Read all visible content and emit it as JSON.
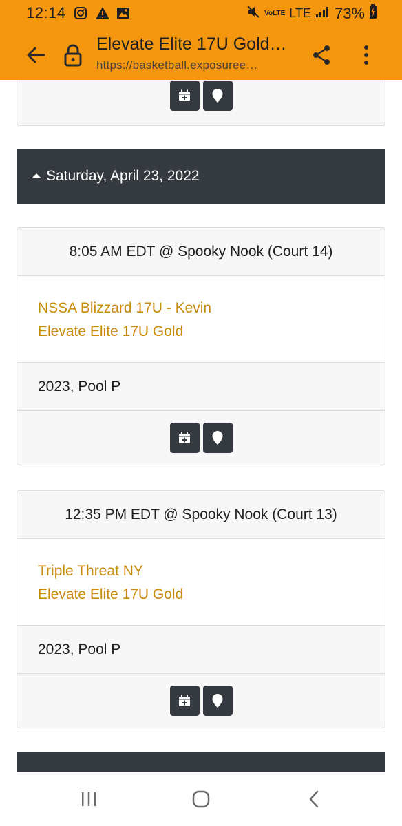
{
  "status_bar": {
    "time": "12:14",
    "volte_label": "VoLTE",
    "network": "LTE",
    "battery": "73%",
    "icons": [
      "instagram-icon",
      "warning-icon",
      "image-icon",
      "mute-icon",
      "signal-icon",
      "battery-charging-icon"
    ]
  },
  "browser": {
    "title": "Elevate Elite 17U Gold…",
    "url": "https://basketball.exposureе…",
    "icons": [
      "back-arrow-icon",
      "lock-icon",
      "share-icon",
      "more-vert-icon"
    ]
  },
  "day": {
    "label": "Saturday, April 23, 2022"
  },
  "games": [
    {
      "header": "8:05 AM EDT @ Spooky Nook (Court 14)",
      "teams": [
        "NSSA Blizzard 17U - Kevin",
        "Elevate Elite 17U Gold"
      ],
      "pool": "2023, Pool P"
    },
    {
      "header": "12:35 PM EDT @ Spooky Nook (Court 13)",
      "teams": [
        "Triple Threat NY",
        "Elevate Elite 17U Gold"
      ],
      "pool": "2023, Pool P"
    }
  ],
  "action_icons": [
    "calendar-add-icon",
    "map-marker-icon"
  ],
  "nav_icons": [
    "recent-apps-icon",
    "home-icon",
    "back-icon"
  ],
  "colors": {
    "app_bar": "#f5960f",
    "dark": "#343a40",
    "team_link": "#c98a0b"
  }
}
